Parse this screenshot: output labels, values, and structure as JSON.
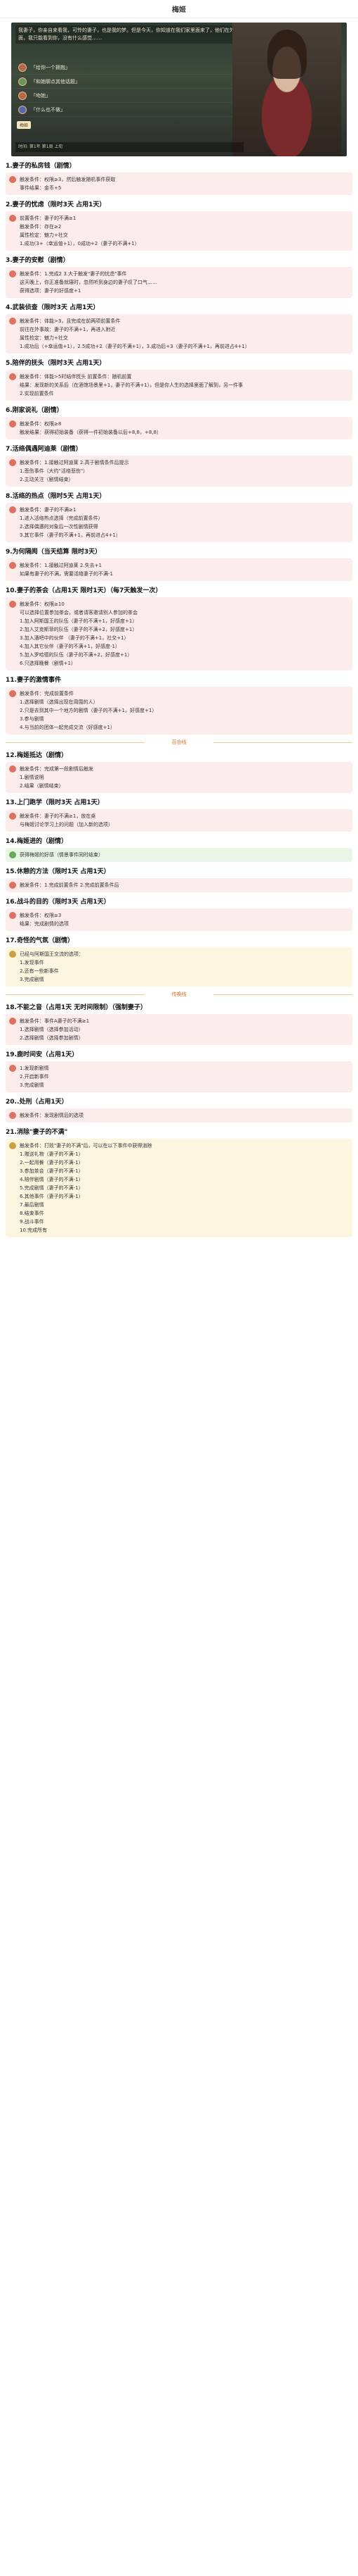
{
  "topbar": {
    "title": "梅姬"
  },
  "shot": {
    "dialog": "我妻子，你亲自来看我，可怜的妻子，也是我的梦。但是今天，你知道在我们家里面来了，他们在外面，我只能看到你，没有什么感觉……",
    "options": [
      "「给你一个拥抱」",
      "「和她聊点其他话题」",
      "「吻她」",
      "「什么也不做」"
    ],
    "tag": "梅姬",
    "bar": "时间: 第1年 第1周 上旬"
  },
  "sections": [
    {
      "title": "1.妻子的私房钱（剧情）",
      "boxes": [
        {
          "c": "pink",
          "lines": [
            "触发条件：权限≥3，然后触发随机事件获取",
            "事件结果：金币+5"
          ]
        }
      ]
    },
    {
      "title": "2.妻子的忧虑（限时3天 占用1天）",
      "boxes": [
        {
          "c": "pink",
          "lines": [
            "前置条件：妻子的不满≥1",
            "触发条件：存在≥2",
            "属性检定：魅力+社交",
            "1.成功(3+（幸运值+1），0成功+2（妻子的不满+1）"
          ]
        }
      ]
    },
    {
      "title": "3.妻子的安慰（剧情）",
      "boxes": [
        {
          "c": "pink",
          "lines": [
            "触发条件：1.完成2 3.大于触发\"妻子的忧虑\"事件",
            "这天晚上，你正准备就寝时，忽然听到身边的妻子叹了口气……",
            "获得选项：妻子的好感度+1"
          ]
        }
      ]
    },
    {
      "title": "4.武装侦查（限时3天 占用1天）",
      "boxes": [
        {
          "c": "pink",
          "lines": [
            "触发条件：体能>3，且完成在前两项前置条件",
            "前往在外事故：妻子的不满+1，再进入附近",
            "属性检定：魅力+社交",
            "1.成功后（+幸运值+1），2.5成功+2（妻子的不满+1），3.成功后+3（妻子的不满+1，再前进占4+1）"
          ]
        }
      ]
    },
    {
      "title": "5.陪伴的抚头（限时3天 占用1天）",
      "boxes": [
        {
          "c": "pink",
          "lines": [
            "触发条件：体能>5时结伴抚头 前置条件：随机前置",
            "结果：发现新的关系后（在酒馆场景里+1，妻子的不满+1），但是你人生的选择里面了解到，另一件事",
            "2.实现前置条件"
          ]
        }
      ]
    },
    {
      "title": "6.刚家说礼（剧情）",
      "boxes": [
        {
          "c": "pink",
          "lines": [
            "触发条件：权限≥8",
            "触发结果：获得初始装备（获得一件初始装备以后+8,8，+8,8）"
          ]
        }
      ]
    },
    {
      "title": "7.活络偶遇阿迪莱（剧情）",
      "boxes": [
        {
          "c": "pink",
          "lines": [
            "触发条件：1.接触过阿迪莱 2.高于剧情条件后提示",
            "1.悲伤事件（大约\"活络悲伤\"）",
            "2.主动关注（剧情结束）"
          ]
        }
      ]
    },
    {
      "title": "8.活络的热点（限时5天 占用1天）",
      "boxes": [
        {
          "c": "pink",
          "lines": [
            "触发条件：妻子的不满≥1",
            "1.进入活络热点选择（完成前置条件）",
            "2.选择偶遇的对象后一次性剧情获得",
            "3.其它事件（妻子的不满+1，再前进占4+1）"
          ]
        }
      ]
    },
    {
      "title": "9.为何隔阂（当天结算 限时3天）",
      "boxes": [
        {
          "c": "pink",
          "lines": [
            "触发条件：1.接触过阿迪莱 2.失去+1",
            "如果有妻子的不满，需要活络妻子的不满-1"
          ]
        }
      ]
    },
    {
      "title": "10.妻子的茶会（占用1天 限时1天）（每7天触发一次）",
      "boxes": [
        {
          "c": "pink",
          "lines": [
            "触发条件：权限≥10",
            "可以选择位置参加茶会，或者请客邀请别人参加的茶会",
            "1.加入阿斯国王的队伍（妻子的不满+1，好感度+1）",
            "2.加入艾克斯菲的队伍（妻子的不满+2，好感度+1）",
            "3.加入酒吧中的伙伴 （妻子的不满+1，社交+1）",
            "4.加入其它伙伴（妻子的不满+1，好感度-1）",
            "5.加入罗哈德的队伍（妻子的不满+2，好感度+1）",
            "6.只选择晚餐（剧情+1）"
          ]
        }
      ]
    },
    {
      "title": "11.妻子的激情事件",
      "boxes": [
        {
          "c": "pink",
          "lines": [
            "触发条件：完成前置条件",
            "1.选择剧情（选择出现在周围的人）",
            "2.只是去到其中一个地方的剧情（妻子的不满+1，好感度+1）",
            "3.参与剧情",
            "4.与当前的团体一起完成交流（好感度+1）"
          ]
        }
      ]
    }
  ],
  "divider1": "百合线",
  "sections2": [
    {
      "title": "12.梅姬抵达（剧情）",
      "boxes": [
        {
          "c": "pink",
          "lines": [
            "触发条件：完成第一段剧情后触发",
            "1.剧情说明",
            "2.结果（剧情结束）"
          ]
        }
      ]
    },
    {
      "title": "13.上门跑学（限时3天 占用1天）",
      "boxes": [
        {
          "c": "pink",
          "lines": [
            "触发条件：妻子的不满≥1，放在桌",
            "与梅姬讨论学习上的问题（加入新的选项）"
          ]
        }
      ]
    },
    {
      "title": "14.梅姬进的（剧情）",
      "boxes": [
        {
          "c": "green",
          "lines": [
            "获得梅姬的好感（情景事件同时结束）"
          ]
        }
      ]
    },
    {
      "title": "15.休憩的方法（限时1天 占用1天）",
      "boxes": [
        {
          "c": "pink",
          "lines": [
            "触发条件：1.完成前置条件 2.完成前置条件后"
          ]
        }
      ]
    },
    {
      "title": "16.战斗的目的（限时3天 占用1天）",
      "boxes": [
        {
          "c": "pink",
          "lines": [
            "触发条件：权限≥3",
            "结果：完成剧情的选项"
          ]
        }
      ]
    },
    {
      "title": "17.奇怪的气氛（剧情）",
      "boxes": [
        {
          "c": "yellow",
          "lines": [
            "已经与阿斯国王交流的选项：",
            "1.发现事件",
            "2.还有一些新事件",
            "3.完成剧情"
          ]
        }
      ]
    }
  ],
  "divider2": "传唤线",
  "sections3": [
    {
      "title": "18.不能之音（占用1天 无时间限制）（强制妻子）",
      "boxes": [
        {
          "c": "pink",
          "lines": [
            "触发条件：事件A妻子的不满≥1",
            "1.选择剧情（选择参加活动）",
            "2.选择剧情（选择参加剧情）"
          ]
        }
      ]
    },
    {
      "title": "19.鹿时间安（占用1天）",
      "boxes": [
        {
          "c": "pink",
          "lines": [
            "1.发现新剧情",
            "2.开启新事件",
            "3.完成剧情"
          ]
        }
      ]
    },
    {
      "title": "20..处刑（占用1天）",
      "boxes": [
        {
          "c": "pink",
          "lines": [
            "触发条件：发现剧情后的选项"
          ]
        }
      ]
    },
    {
      "title": "21.消除\"妻子的不满\"",
      "boxes": [
        {
          "c": "yellow",
          "lines": [
            "触发条件：打败\"妻子的不满\"后，可以在以下事件中获得消除",
            "1.赠送礼物（妻子的不满-1）",
            "2.一起用餐（妻子的不满-1）",
            "3.参加茶会（妻子的不满-1）",
            "4.陪伴剧情（妻子的不满-1）",
            "5.完成剧情（妻子的不满-1）",
            "6.其他事件（妻子的不满-1）",
            "7.最后剧情",
            "8.结束事件",
            "9.战斗事件",
            "10.完成所有"
          ]
        }
      ]
    }
  ]
}
